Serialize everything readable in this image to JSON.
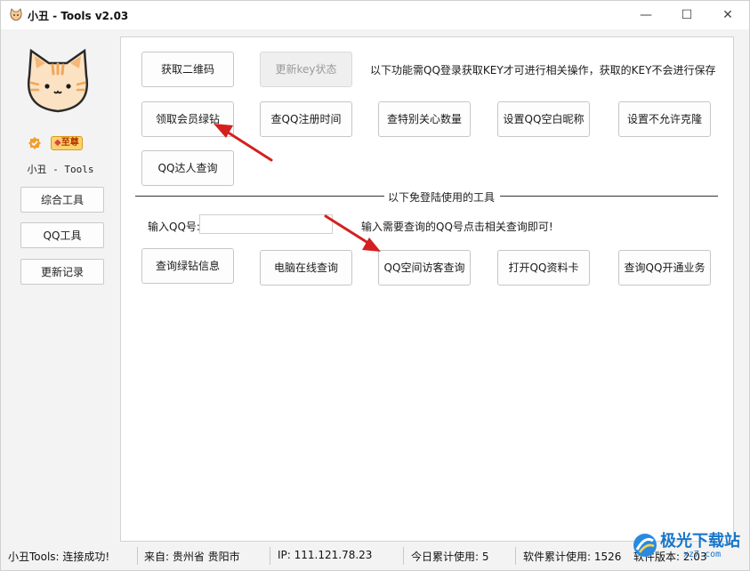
{
  "window": {
    "title": "小丑 - Tools v2.03",
    "controls": {
      "minimize": "—",
      "maximize": "☐",
      "close": "✕"
    }
  },
  "sidebar": {
    "vip_badge": "至尊",
    "app_name": "小丑 - Tools",
    "nav": [
      {
        "label": "综合工具"
      },
      {
        "label": "QQ工具"
      },
      {
        "label": "更新记录"
      }
    ]
  },
  "main": {
    "login_row": {
      "get_qrcode": "获取二维码",
      "update_key": "更新key状态",
      "notice": "以下功能需QQ登录获取KEY才可进行相关操作，获取的KEY不会进行保存"
    },
    "key_buttons": [
      "领取会员绿钻",
      "查QQ注册时间",
      "查特别关心数量",
      "设置QQ空白昵称",
      "设置不允许克隆",
      "QQ达人查询"
    ],
    "divider_label": "以下免登陆使用的工具",
    "qq_input": {
      "label": "输入QQ号:",
      "value": "",
      "hint": "输入需要查询的QQ号点击相关查询即可!"
    },
    "free_buttons": [
      "查询绿钻信息",
      "电脑在线查询",
      "QQ空间访客查询",
      "打开QQ资料卡",
      "查询QQ开通业务"
    ]
  },
  "statusbar": {
    "status": "小丑Tools: 连接成功!",
    "location": "来自: 贵州省 贵阳市",
    "ip": "IP: 111.121.78.23",
    "today": "今日累计使用: 5",
    "total": "软件累计使用: 1526",
    "version": "软件版本: 2.03"
  },
  "watermark": {
    "text": "极光下载站",
    "sub": "xz7.com"
  },
  "colors": {
    "arrow": "#d42020",
    "accent": "#1976c8"
  }
}
